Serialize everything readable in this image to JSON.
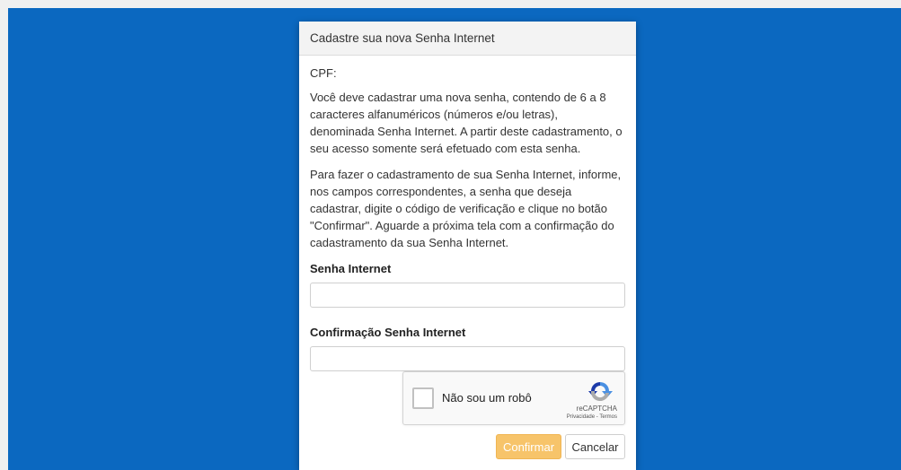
{
  "modal": {
    "title": "Cadastre sua nova Senha Internet",
    "cpf_label": "CPF:",
    "paragraph1": "Você deve cadastrar uma nova senha, contendo de 6 a 8 caracteres alfanuméricos (números e/ou letras), denominada Senha Internet. A partir deste cadastramento, o seu acesso somente será efetuado com esta senha.",
    "paragraph2": "Para fazer o cadastramento de sua Senha Internet, informe, nos campos correspondentes, a senha que deseja cadastrar, digite o código de verificação e clique no botão \"Confirmar\". Aguarde a próxima tela com a confirmação do cadastramento da sua Senha Internet."
  },
  "form": {
    "password_label": "Senha Internet",
    "password_value": "",
    "confirm_label": "Confirmação Senha Internet",
    "confirm_value": ""
  },
  "recaptcha": {
    "label": "Não sou um robô",
    "brand": "reCAPTCHA",
    "links": "Privacidade - Termos",
    "icon": "recaptcha-logo"
  },
  "buttons": {
    "confirm": "Confirmar",
    "cancel": "Cancelar"
  },
  "colors": {
    "backdrop": "#0b68c0",
    "confirm_button": "#f7c46a"
  }
}
